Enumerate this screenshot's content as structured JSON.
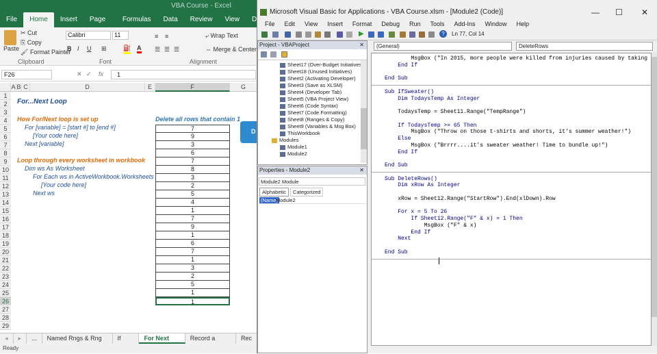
{
  "excel": {
    "title_right": "VBA Course - Excel",
    "tabs": [
      "File",
      "Home",
      "Insert",
      "Page Layout",
      "Formulas",
      "Data",
      "Review",
      "View",
      "Developer"
    ],
    "active_tab": "Home",
    "clipboard": {
      "cut": "Cut",
      "copy": "Copy",
      "format_painter": "Format Painter",
      "paste": "Paste",
      "group": "Clipboard"
    },
    "font": {
      "name": "Calibri",
      "size": "11",
      "group": "Font"
    },
    "alignment": {
      "wrap": "Wrap Text",
      "merge": "Merge & Center",
      "group": "Alignment"
    },
    "name_box": "F26",
    "formula_value": "1",
    "columns": [
      "A",
      "B",
      "C",
      "D",
      "E",
      "F",
      "G"
    ],
    "rows": [
      "1",
      "2",
      "3",
      "4",
      "5",
      "6",
      "7",
      "8",
      "9",
      "10",
      "11",
      "12",
      "13",
      "14",
      "15",
      "16",
      "17",
      "18",
      "19",
      "20",
      "21",
      "22",
      "23",
      "24",
      "25",
      "26",
      "27",
      "28",
      "29"
    ],
    "heading": "For...Next Loop",
    "how_title": "How For/Next loop is set up",
    "for_line": "For [variable] = [start #] to [end #]",
    "code_here_1": "[Your code here]",
    "next_line": "Next [variable]",
    "loop_title": "Loop through every worksheet in workbook",
    "dim_line": "Dim ws As Worksheet",
    "foreach_line": "For Each ws in ActiveWorkbook.Worksheets",
    "code_here_2": "[Your code here]",
    "next_ws": "Next ws",
    "delete_header": "Delete all rows that contain 1",
    "col_f_values": [
      "7",
      "9",
      "3",
      "6",
      "7",
      "8",
      "3",
      "2",
      "5",
      "4",
      "1",
      "7",
      "9",
      "1",
      "6",
      "7",
      "1",
      "3",
      "2",
      "5",
      "1",
      "1"
    ],
    "sheet_tabs": [
      "Named Rngs & Rng Func",
      "If Then",
      "For Next Loop",
      "Record a Macro I",
      "Rec"
    ],
    "active_sheet": "For Next Loop",
    "status": "Ready"
  },
  "vba": {
    "title": "Microsoft Visual Basic for Applications - VBA Course.xlsm - [Module2 (Code)]",
    "menu": [
      "File",
      "Edit",
      "View",
      "Insert",
      "Format",
      "Debug",
      "Run",
      "Tools",
      "Add-Ins",
      "Window",
      "Help"
    ],
    "cursor_pos": "Ln 77, Col 14",
    "project_title": "Project - VBAProject",
    "project_items": [
      "Sheet17 (Over-Budget Initiatives)",
      "Sheet18 (Unused Initiatives)",
      "Sheet2 (Activating Developer)",
      "Sheet3 (Save as XLSM)",
      "Sheet4 (Developer Tab)",
      "Sheet5 (VBA Project View)",
      "Sheet6 (Code Syntax)",
      "Sheet7 (Code Formatting)",
      "Sheet8 (Ranges & Copy)",
      "Sheet9 (Variables & Msg Box)",
      "ThisWorkbook",
      "Modules",
      "Module1",
      "Module2"
    ],
    "props_title": "Properties - Module2",
    "props_object": "Module2 Module",
    "props_tabs": [
      "Alphabetic",
      "Categorized"
    ],
    "props_name_key": "(Name)",
    "props_name_val": "Module2",
    "general_dd": "(General)",
    "proc_dd": "DeleteRows",
    "code_lines": [
      "        MsgBox (\"In 2015, more people were killed from injuries caused by taking",
      "    End If",
      "",
      "End Sub",
      "",
      "Sub IfSweater()",
      "    Dim TodaysTemp As Integer",
      "",
      "    TodaysTemp = Sheet11.Range(\"TempRange\")",
      "",
      "    If TodaysTemp >= 65 Then",
      "        MsgBox (\"Throw on those t-shirts and shorts, it's summer weather!\")",
      "    Else",
      "        MsgBox (\"Brrrr....it's sweater weather! Time to bundle up!\")",
      "    End If",
      "",
      "End Sub",
      "",
      "Sub DeleteRows()",
      "    Dim xRow As Integer",
      "",
      "    xRow = Sheet12.Range(\"StartRow\").End(xlDown).Row",
      "",
      "    For x = 5 To 26",
      "        If Sheet12.Range(\"F\" & x) = 1 Then",
      "            MsgBox (\"F\" & x)",
      "        End If",
      "    Next",
      "",
      "End Sub"
    ]
  }
}
